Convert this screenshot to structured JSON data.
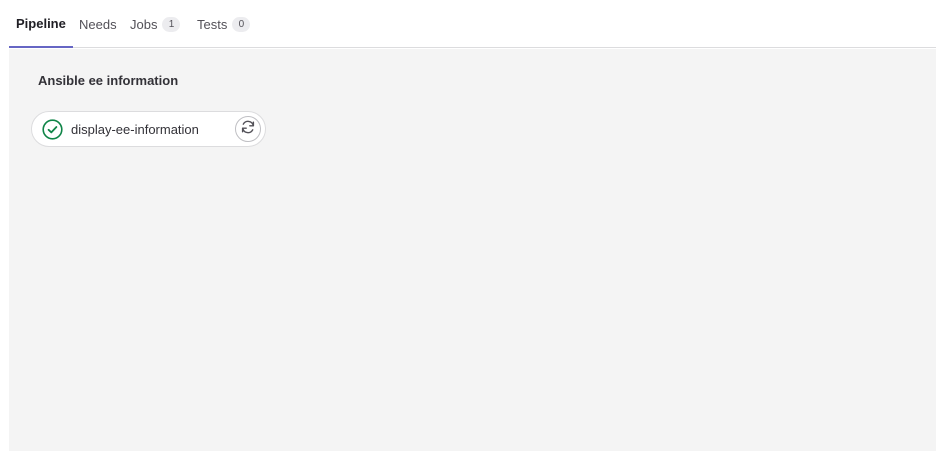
{
  "tabs": [
    {
      "label": "Pipeline",
      "active": true
    },
    {
      "label": "Needs"
    },
    {
      "label": "Jobs",
      "count": "1"
    },
    {
      "label": "Tests",
      "count": "0"
    }
  ],
  "stage": {
    "title": "Ansible ee information",
    "jobs": [
      {
        "name": "display-ee-information",
        "status": "passed",
        "status_icon": "check-circle-icon",
        "status_color": "#108548",
        "action_icon": "retry-icon"
      }
    ]
  },
  "colors": {
    "active_tab_underline": "#6666c4",
    "panel_background": "#f4f4f4"
  }
}
